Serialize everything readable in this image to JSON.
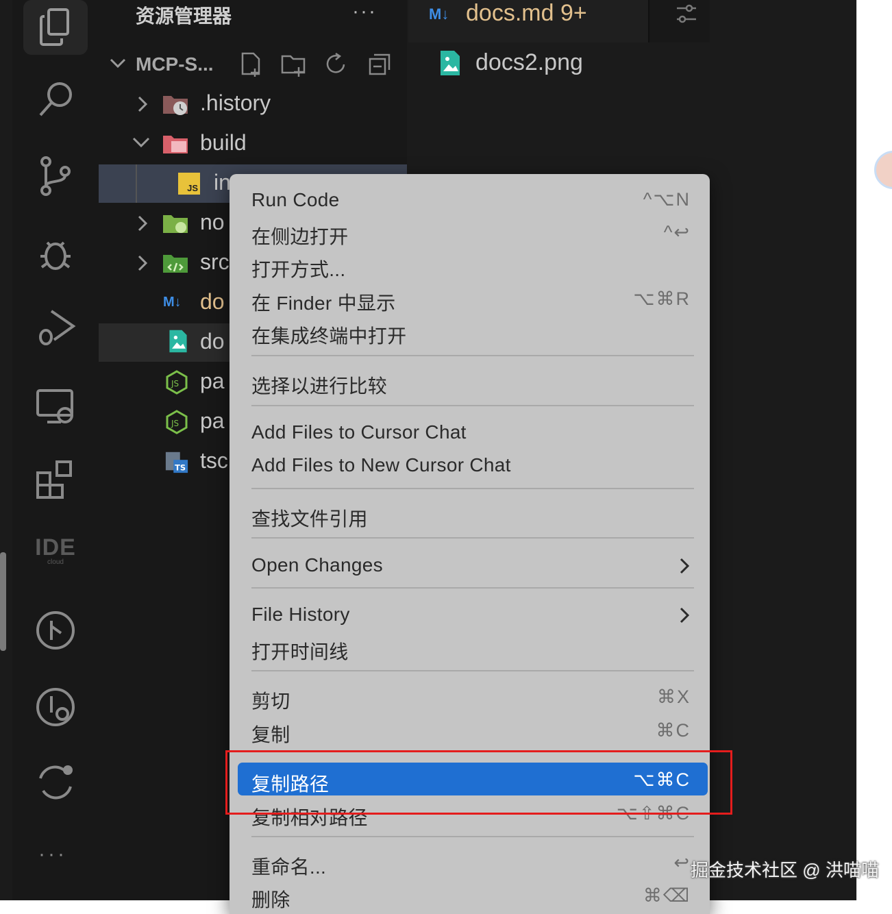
{
  "sidebar": {
    "title": "资源管理器",
    "more": "···",
    "project": "MCP-S...",
    "tree": [
      {
        "label": ".history"
      },
      {
        "label": "build"
      },
      {
        "label": "in",
        "badge": "JS"
      },
      {
        "label": "no"
      },
      {
        "label": "src"
      },
      {
        "label": "do"
      },
      {
        "label": "do"
      },
      {
        "label": "pa"
      },
      {
        "label": "pa"
      },
      {
        "label": "tsc"
      }
    ]
  },
  "editor": {
    "tab": {
      "icon": "M↓",
      "title": "docs.md 9+"
    },
    "file": "docs2.png"
  },
  "activity": {
    "ide_logo": "IDE",
    "ide_sub": "cloud",
    "more": "···"
  },
  "menu": {
    "items": [
      {
        "label": "Run Code",
        "shortcut": "^⌥N"
      },
      {
        "label": "在侧边打开",
        "shortcut": "^↩"
      },
      {
        "label": "打开方式..."
      },
      {
        "label": "在 Finder 中显示",
        "shortcut": "⌥⌘R"
      },
      {
        "label": "在集成终端中打开"
      },
      {
        "label": "选择以进行比较"
      },
      {
        "label": "Add Files to Cursor Chat"
      },
      {
        "label": "Add Files to New Cursor Chat"
      },
      {
        "label": "查找文件引用"
      },
      {
        "label": "Open Changes"
      },
      {
        "label": "File History"
      },
      {
        "label": "打开时间线"
      },
      {
        "label": "剪切",
        "shortcut": "⌘X"
      },
      {
        "label": "复制",
        "shortcut": "⌘C"
      },
      {
        "label": "复制路径",
        "shortcut": "⌥⌘C",
        "highlighted": true
      },
      {
        "label": "复制相对路径",
        "shortcut": "⌥⇧⌘C"
      },
      {
        "label": "重命名...",
        "shortcut": "↩"
      },
      {
        "label": "删除",
        "shortcut": "⌘⌫"
      }
    ]
  },
  "watermark": "掘金技术社区 @ 洪喵喵",
  "colors": {
    "highlight": "#1f6fd2",
    "annotation": "#e41d1d",
    "modified": "#e2c08d",
    "menu_bg": "#c5c5c5"
  }
}
